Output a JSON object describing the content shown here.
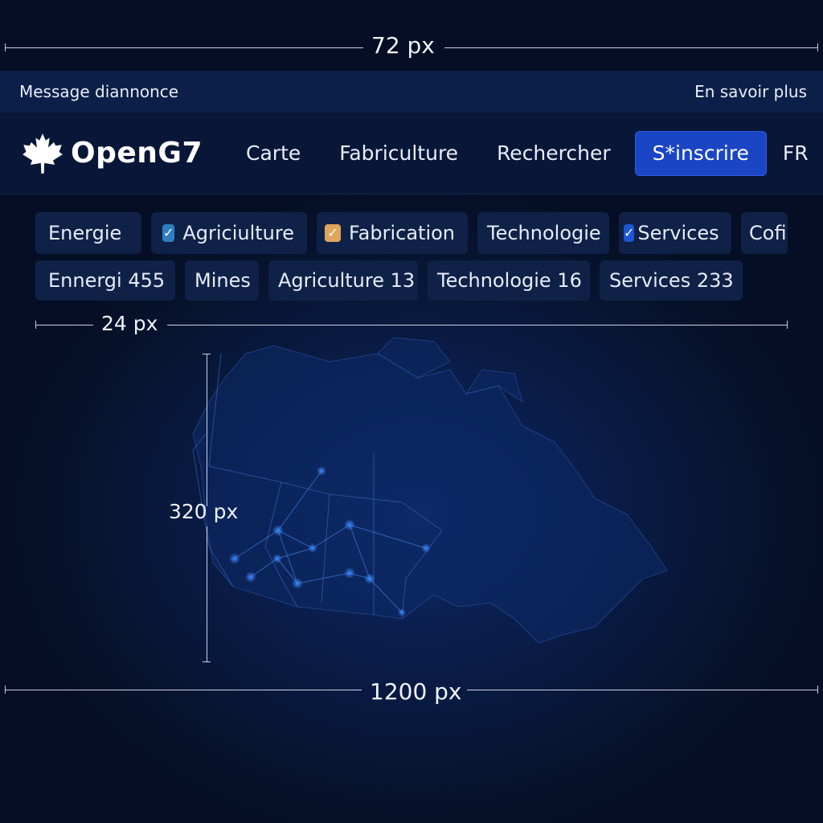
{
  "annotations": {
    "top_width": "72 px",
    "gap": "24 px",
    "map_height": "320 px",
    "bottom_width": "1200 px"
  },
  "announcement": {
    "message": "Message diannonce",
    "link": "En savoir plus"
  },
  "navbar": {
    "brand": "OpenG7",
    "logo_icon": "maple-leaf-icon",
    "items": [
      "Carte",
      "Fabriculture",
      "Rechercher"
    ],
    "cta": "S*inscrire",
    "language": "FR",
    "cta_color": "#1a45c4"
  },
  "filters": {
    "row1": [
      {
        "label": "Energie",
        "checked": false
      },
      {
        "label": "Agriciulture",
        "checked": true,
        "color": "#2f7fc1"
      },
      {
        "label": "Fabrication",
        "checked": true,
        "color": "#e0a45c"
      },
      {
        "label": "Technologie",
        "checked": false
      },
      {
        "label": "Services",
        "checked": true,
        "color": "#1b57d6"
      },
      {
        "label": "Cofi",
        "checked": false
      }
    ],
    "row2": [
      {
        "label": "Ennergi 455"
      },
      {
        "label": "Mines"
      },
      {
        "label": "Agriculture 13"
      },
      {
        "label": "Technologie 16"
      },
      {
        "label": "Services 233"
      }
    ]
  },
  "map": {
    "node_color": "#3d8bff",
    "outline_color": "#2e5bb0"
  }
}
